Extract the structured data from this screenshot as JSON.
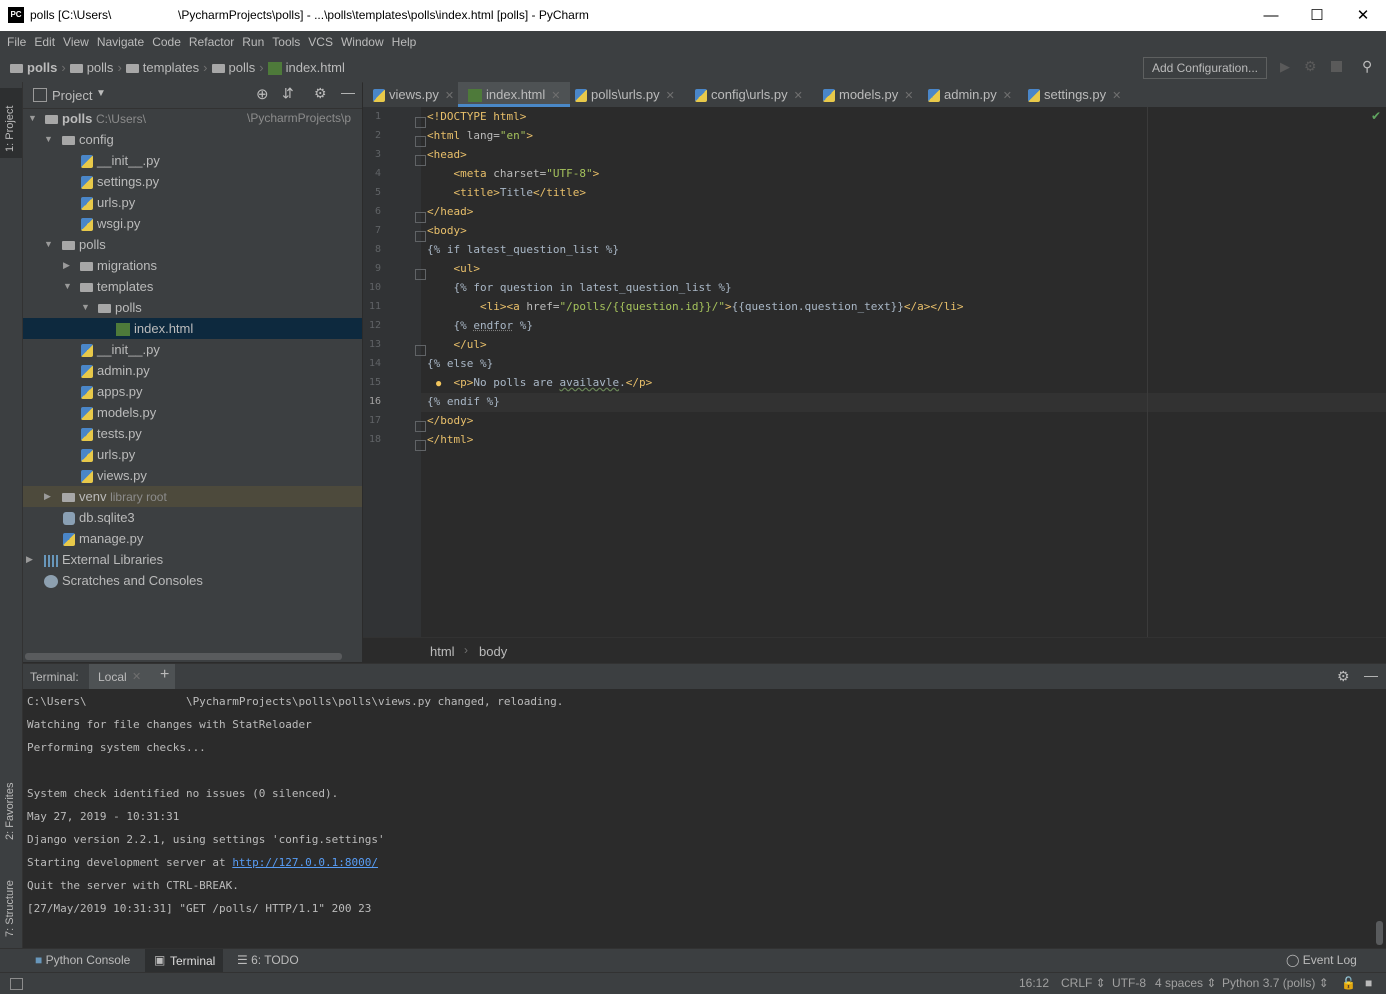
{
  "window": {
    "title": "polls [C:\\Users\\                    \\PycharmProjects\\polls] - ...\\polls\\templates\\polls\\index.html [polls] - PyCharm",
    "app_icon": "PC"
  },
  "menu": [
    "File",
    "Edit",
    "View",
    "Navigate",
    "Code",
    "Refactor",
    "Run",
    "Tools",
    "VCS",
    "Window",
    "Help"
  ],
  "breadcrumbs": [
    "polls",
    "polls",
    "templates",
    "polls",
    "index.html"
  ],
  "toolbar": {
    "add_configuration": "Add Configuration..."
  },
  "left_strip": {
    "project_tab": "1: Project",
    "favorites_tab": "2: Favorites",
    "structure_tab": "7: Structure"
  },
  "project": {
    "header": "Project",
    "root_name": "polls",
    "root_path": "C:\\Users\\",
    "root_path2": "\\PycharmProjects\\p",
    "tree": [
      {
        "label": "config",
        "type": "folder"
      },
      {
        "label": "__init__.py",
        "type": "py"
      },
      {
        "label": "settings.py",
        "type": "py"
      },
      {
        "label": "urls.py",
        "type": "py"
      },
      {
        "label": "wsgi.py",
        "type": "py"
      },
      {
        "label": "polls",
        "type": "folder"
      },
      {
        "label": "migrations",
        "type": "folder"
      },
      {
        "label": "templates",
        "type": "folder"
      },
      {
        "label": "polls",
        "type": "folder"
      },
      {
        "label": "index.html",
        "type": "html"
      },
      {
        "label": "__init__.py",
        "type": "py"
      },
      {
        "label": "admin.py",
        "type": "py"
      },
      {
        "label": "apps.py",
        "type": "py"
      },
      {
        "label": "models.py",
        "type": "py"
      },
      {
        "label": "tests.py",
        "type": "py"
      },
      {
        "label": "urls.py",
        "type": "py"
      },
      {
        "label": "views.py",
        "type": "py"
      },
      {
        "label": "venv",
        "type": "folder",
        "suffix": "library root"
      },
      {
        "label": "db.sqlite3",
        "type": "db"
      },
      {
        "label": "manage.py",
        "type": "py"
      },
      {
        "label": "External Libraries",
        "type": "lib"
      },
      {
        "label": "Scratches and Consoles",
        "type": "scratch"
      }
    ]
  },
  "tabs": [
    "views.py",
    "index.html",
    "polls\\urls.py",
    "config\\urls.py",
    "models.py",
    "admin.py",
    "settings.py"
  ],
  "editor": {
    "line_numbers": [
      "1",
      "2",
      "3",
      "4",
      "5",
      "6",
      "7",
      "8",
      "9",
      "10",
      "11",
      "12",
      "13",
      "14",
      "15",
      "16",
      "17",
      "18"
    ],
    "breadcrumb": [
      "html",
      "body"
    ]
  },
  "terminal": {
    "label": "Terminal:",
    "tab": "Local",
    "lines": [
      "C:\\Users\\               \\PycharmProjects\\polls\\polls\\views.py changed, reloading.",
      "Watching for file changes with StatReloader",
      "Performing system checks...",
      "",
      "System check identified no issues (0 silenced).",
      "May 27, 2019 - 10:31:31",
      "Django version 2.2.1, using settings 'config.settings'",
      "Starting development server at ",
      "Quit the server with CTRL-BREAK.",
      "[27/May/2019 10:31:31] \"GET /polls/ HTTP/1.1\" 200 23"
    ],
    "server_url": "http://127.0.0.1:8000/"
  },
  "bottom_tabs": {
    "python_console": "Python Console",
    "terminal": "Terminal",
    "todo": "6: TODO",
    "event_log": "Event Log"
  },
  "status": {
    "position": "16:12",
    "line_sep": "CRLF",
    "encoding": "UTF-8",
    "indent": "4 spaces",
    "interpreter": "Python 3.7 (polls)"
  }
}
